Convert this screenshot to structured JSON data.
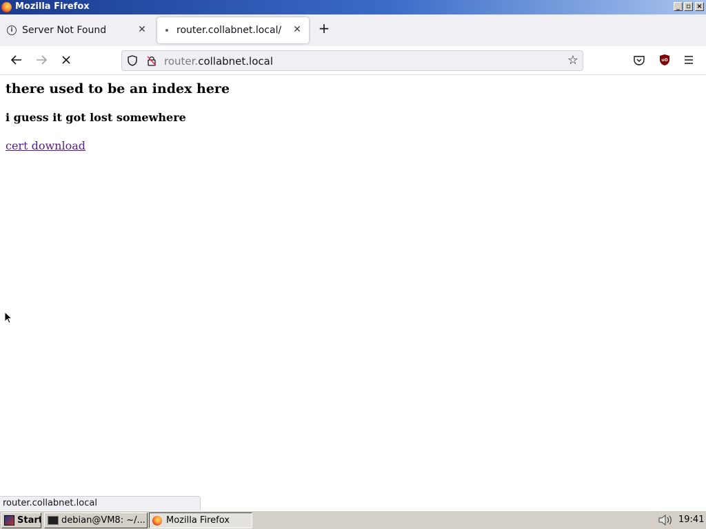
{
  "window": {
    "title": "Mozilla Firefox"
  },
  "tabs": [
    {
      "label": "Server Not Found",
      "active": false,
      "icon": "info-icon"
    },
    {
      "label": "router.collabnet.local/",
      "active": true,
      "icon": "loading-dot-icon"
    }
  ],
  "navbar": {
    "url_prefix": "router.",
    "url_domain": "collabnet.local"
  },
  "page": {
    "heading": "there used to be an index here",
    "subheading": "i guess it got lost somewhere",
    "link_label": "cert download"
  },
  "statusbar": {
    "text": "router.collabnet.local"
  },
  "taskbar": {
    "start_label": "Start",
    "tasks": [
      {
        "label": "debian@VM8: ~/...",
        "icon": "terminal-icon"
      },
      {
        "label": "Mozilla Firefox",
        "icon": "firefox-icon"
      }
    ],
    "clock": "19:41"
  },
  "colors": {
    "titlebar_left": "#1a3a8f",
    "visited_link": "#551a8b",
    "ublock_red": "#800000"
  }
}
